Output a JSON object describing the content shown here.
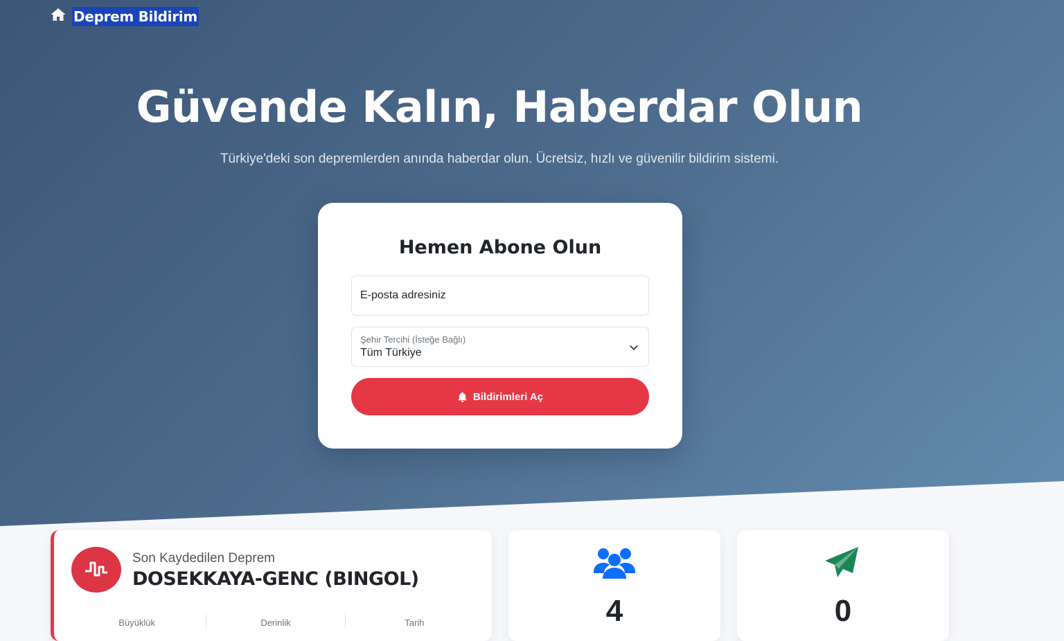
{
  "nav": {
    "brand": "Deprem Bildirim",
    "icon": "home-icon"
  },
  "hero": {
    "title": "Güvende Kalın, Haberdar Olun",
    "subtitle": "Türkiye'deki son depremlerden anında haberdar olun. Ücretsiz, hızlı ve güvenilir bildirim sistemi."
  },
  "subscribe": {
    "title": "Hemen Abone Olun",
    "email_placeholder": "E-posta adresiniz",
    "city_label": "Şehir Tercihi (İsteğe Bağlı)",
    "city_value": "Tüm Türkiye",
    "button_label": "Bildirimleri Aç"
  },
  "latest_quake": {
    "label": "Son Kaydedilen Deprem",
    "location": "DOSEKKAYA-GENC (BINGOL)",
    "stats": [
      "Büyüklük",
      "Derinlik",
      "Tarih"
    ]
  },
  "stats": {
    "subscribers": "4",
    "sent": "0"
  },
  "colors": {
    "accent": "#e63746",
    "brand_highlight": "#1a44b8",
    "users_icon": "#0d6efd",
    "send_icon": "#198754"
  }
}
